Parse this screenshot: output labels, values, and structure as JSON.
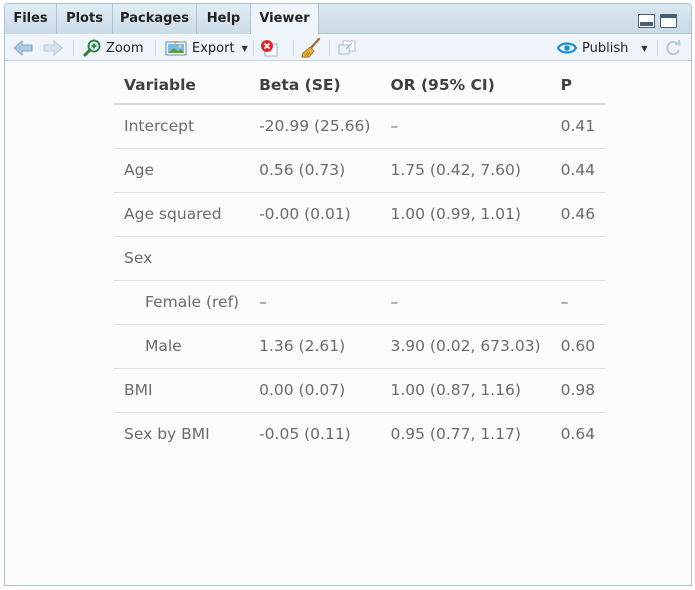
{
  "tabs": [
    {
      "label": "Files",
      "active": false
    },
    {
      "label": "Plots",
      "active": false
    },
    {
      "label": "Packages",
      "active": false
    },
    {
      "label": "Help",
      "active": false
    },
    {
      "label": "Viewer",
      "active": true
    }
  ],
  "toolbar": {
    "back_icon": "arrow-left-icon",
    "forward_icon": "arrow-right-icon",
    "zoom_label": "Zoom",
    "export_label": "Export",
    "remove_icon": "remove-viewer-icon",
    "clear_icon": "broom-icon",
    "popout_icon": "show-in-new-window-icon",
    "publish_label": "Publish",
    "refresh_icon": "refresh-icon"
  },
  "table": {
    "headers": [
      "Variable",
      "Beta (SE)",
      "OR (95% CI)",
      "P"
    ],
    "rows": [
      {
        "variable": "Intercept",
        "beta": "-20.99 (25.66)",
        "or": "–",
        "p": "0.41",
        "indent": false
      },
      {
        "variable": "Age",
        "beta": "0.56 (0.73)",
        "or": "1.75 (0.42, 7.60)",
        "p": "0.44",
        "indent": false
      },
      {
        "variable": "Age squared",
        "beta": "-0.00 (0.01)",
        "or": "1.00 (0.99, 1.01)",
        "p": "0.46",
        "indent": false
      },
      {
        "variable": "Sex",
        "beta": "",
        "or": "",
        "p": "",
        "indent": false
      },
      {
        "variable": "Female (ref)",
        "beta": "–",
        "or": "–",
        "p": "–",
        "indent": true
      },
      {
        "variable": "Male",
        "beta": "1.36 (2.61)",
        "or": "3.90 (0.02, 673.03)",
        "p": "0.60",
        "indent": true
      },
      {
        "variable": "BMI",
        "beta": "0.00 (0.07)",
        "or": "1.00 (0.87, 1.16)",
        "p": "0.98",
        "indent": false
      },
      {
        "variable": "Sex by BMI",
        "beta": "-0.05 (0.11)",
        "or": "0.95 (0.77, 1.17)",
        "p": "0.64",
        "indent": false
      }
    ]
  },
  "colors": {
    "accent": "#1b8fd0",
    "pane_border": "#a9c3d6",
    "toolbar_bg": "#eef4f9"
  }
}
